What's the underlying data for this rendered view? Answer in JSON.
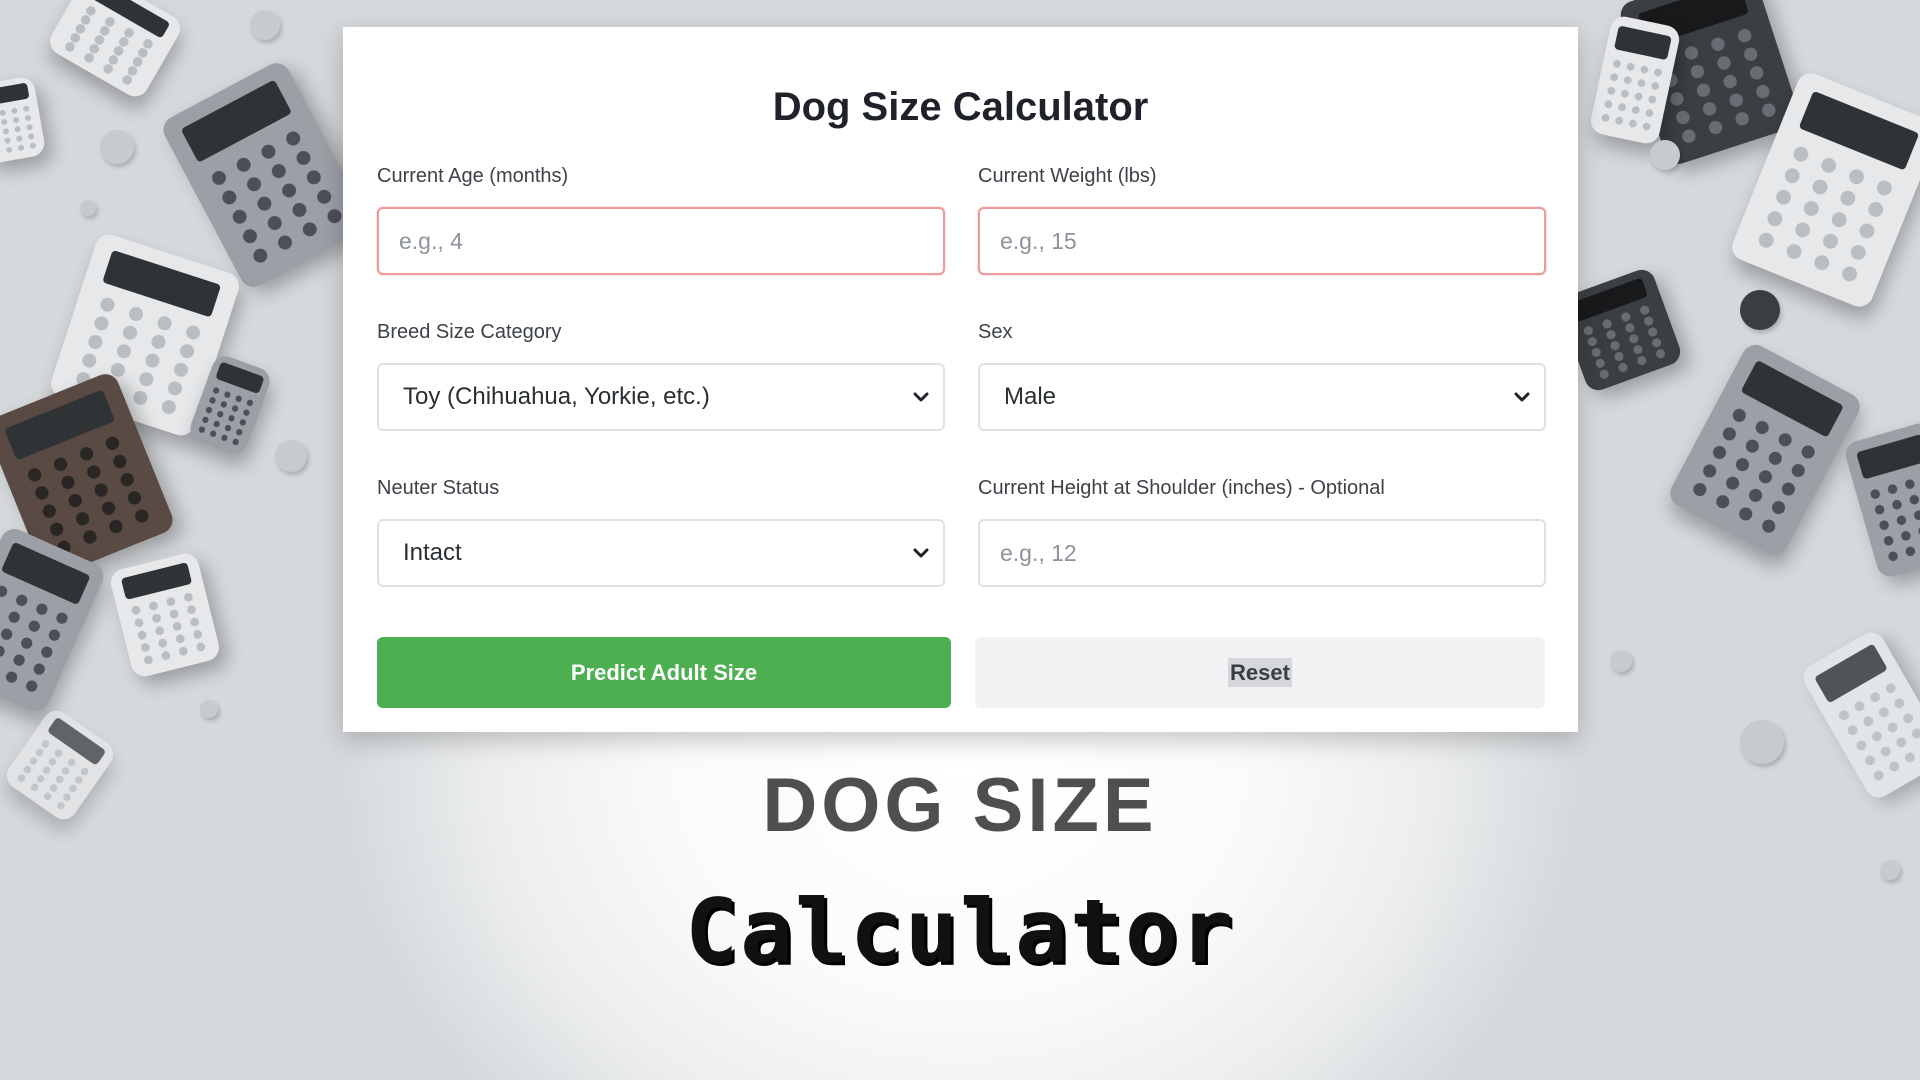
{
  "card": {
    "title": "Dog Size Calculator"
  },
  "fields": {
    "age": {
      "label": "Current Age (months)",
      "placeholder": "e.g., 4"
    },
    "weight": {
      "label": "Current Weight (lbs)",
      "placeholder": "e.g., 15"
    },
    "breed_size": {
      "label": "Breed Size Category",
      "value": "Toy (Chihuahua, Yorkie, etc.)"
    },
    "sex": {
      "label": "Sex",
      "value": "Male"
    },
    "neuter": {
      "label": "Neuter Status",
      "value": "Intact"
    },
    "height": {
      "label": "Current Height at Shoulder (inches) - Optional",
      "placeholder": "e.g., 12"
    }
  },
  "buttons": {
    "predict": "Predict Adult Size",
    "reset": "Reset"
  },
  "headline": {
    "line1": "DOG SIZE",
    "line2": "Calculator"
  },
  "colors": {
    "primary": "#4caf50",
    "error_border": "#ec9a9a",
    "secondary_bg": "#f1f2f3"
  },
  "icons": {
    "dropdown": "chevron-down-icon",
    "background": "calculator-icon"
  }
}
